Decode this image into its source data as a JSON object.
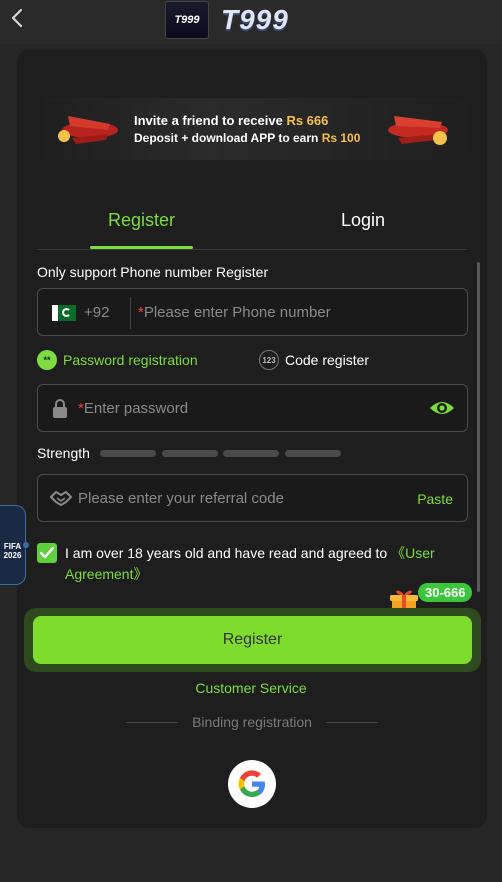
{
  "header": {
    "logo_badge": "T999",
    "logo_text": "T999"
  },
  "banner": {
    "line1_prefix": "Invite a friend to receive ",
    "line1_amount": "Rs 666",
    "line2_prefix": "Deposit + download APP to earn ",
    "line2_amount": "Rs 100"
  },
  "tabs": [
    {
      "label": "Register",
      "active": true
    },
    {
      "label": "Login",
      "active": false
    }
  ],
  "form": {
    "section_label": "Only support Phone number Register",
    "country_code": "+92",
    "phone_placeholder": "Please enter Phone number",
    "modes": [
      {
        "label": "Password registration",
        "icon": "**",
        "active": true
      },
      {
        "label": "Code register",
        "icon": "123",
        "active": false
      }
    ],
    "password_placeholder": "Enter password",
    "strength_label": "Strength",
    "strength_levels": 4,
    "referral_placeholder": "Please enter your referral code",
    "paste_label": "Paste",
    "agreement_text": "I am over 18 years old and have read and agreed to ",
    "agreement_link": "《User Agreement》",
    "agreement_checked": true,
    "register_button": "Register",
    "promo_badge": "30-666"
  },
  "footer": {
    "customer_service": "Customer Service",
    "binding_label": "Binding registration",
    "google_icon": "google-icon"
  },
  "side_badge": {
    "line1": "FIFA",
    "line2": "2026"
  },
  "colors": {
    "accent": "#7ddc3f",
    "background": "#262626",
    "card": "#1e1e1e",
    "required": "#e5443a"
  }
}
